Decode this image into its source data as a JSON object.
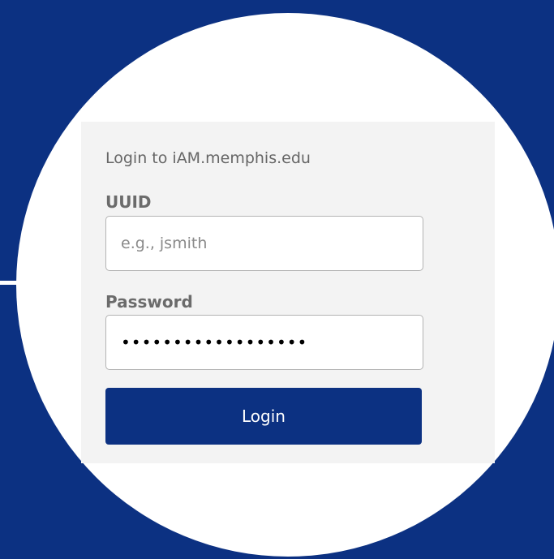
{
  "colors": {
    "background": "#0c3182",
    "circle": "#ffffff",
    "panel": "#f3f3f3",
    "button": "#0c3182",
    "button_text": "#ffffff",
    "label_text": "#6b6b6b"
  },
  "login_form": {
    "heading": "Login to iAM.memphis.edu",
    "uuid": {
      "label": "UUID",
      "placeholder": "e.g., jsmith",
      "value": ""
    },
    "password": {
      "label": "Password",
      "value": "••••••••••••••••••"
    },
    "submit_label": "Login"
  }
}
